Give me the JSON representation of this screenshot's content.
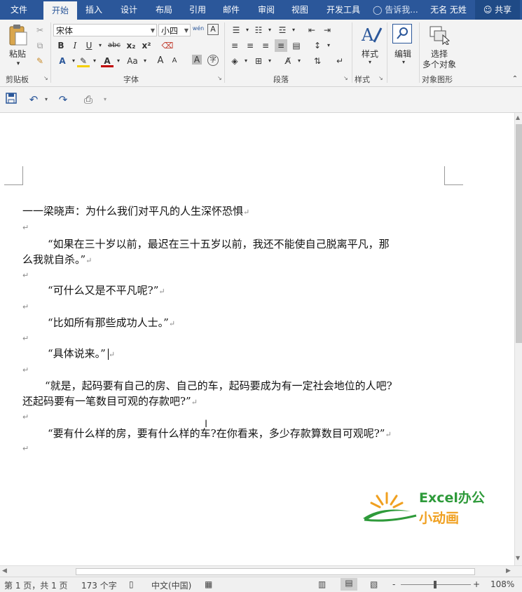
{
  "menu": {
    "file": "文件",
    "home": "开始",
    "insert": "插入",
    "design": "设计",
    "layout": "布局",
    "references": "引用",
    "mailings": "邮件",
    "review": "审阅",
    "view": "视图",
    "developer": "开发工具",
    "tell_me": "告诉我...",
    "user": "无名 无姓",
    "share": "共享"
  },
  "ribbon": {
    "clipboard": {
      "paste": "粘贴",
      "label": "剪贴板"
    },
    "font": {
      "name": "宋体",
      "size": "小四",
      "label": "字体",
      "bold": "B",
      "italic": "I",
      "underline": "U",
      "strike": "abc",
      "subscript": "x₂",
      "superscript": "x²",
      "change_case": "Aa",
      "grow": "A",
      "shrink": "A",
      "phonetic": "wén"
    },
    "paragraph": {
      "label": "段落"
    },
    "styles": {
      "button": "样式",
      "label": "样式"
    },
    "editing": {
      "button": "编辑"
    },
    "select": {
      "line1": "选择",
      "line2": "多个对象",
      "label": "对象图形"
    }
  },
  "document": {
    "paragraphs": [
      "一一梁晓声：为什么我们对平凡的人生深怀恐惧",
      "“如果在三十岁以前，最迟在三十五岁以前，我还不能使自己脱离平凡，那",
      "么我就自杀。”",
      "“可什么又是不平凡呢?”",
      "“比如所有那些成功人士。”",
      "“具体说来。”",
      "“就是，起码要有自己的房、自己的车，起码要成为有一定社会地位的人吧?",
      "还起码要有一笔数目可观的存款吧?”",
      "“要有什么样的房，要有什么样的车?在你看来，多少存款算数目可观呢?”"
    ],
    "logo": {
      "line1": "Excel办公",
      "line2": "小动画"
    }
  },
  "status": {
    "page": "第 1 页，共 1 页",
    "words": "173 个字",
    "language": "中文(中国)",
    "zoom": "108%",
    "zoom_minus": "-",
    "zoom_plus": "+"
  },
  "colors": {
    "accent": "#2b579a",
    "ribbon": "#f3f3f3",
    "logo_green": "#2e9a3a",
    "logo_orange": "#f0a020"
  },
  "icons": [
    "save-icon",
    "undo-icon",
    "redo-icon",
    "print-preview-icon",
    "lightbulb-icon",
    "person-icon",
    "paste-icon",
    "cut-icon",
    "copy-icon",
    "format-painter-icon",
    "styles-icon",
    "search-icon",
    "select-objects-icon"
  ]
}
